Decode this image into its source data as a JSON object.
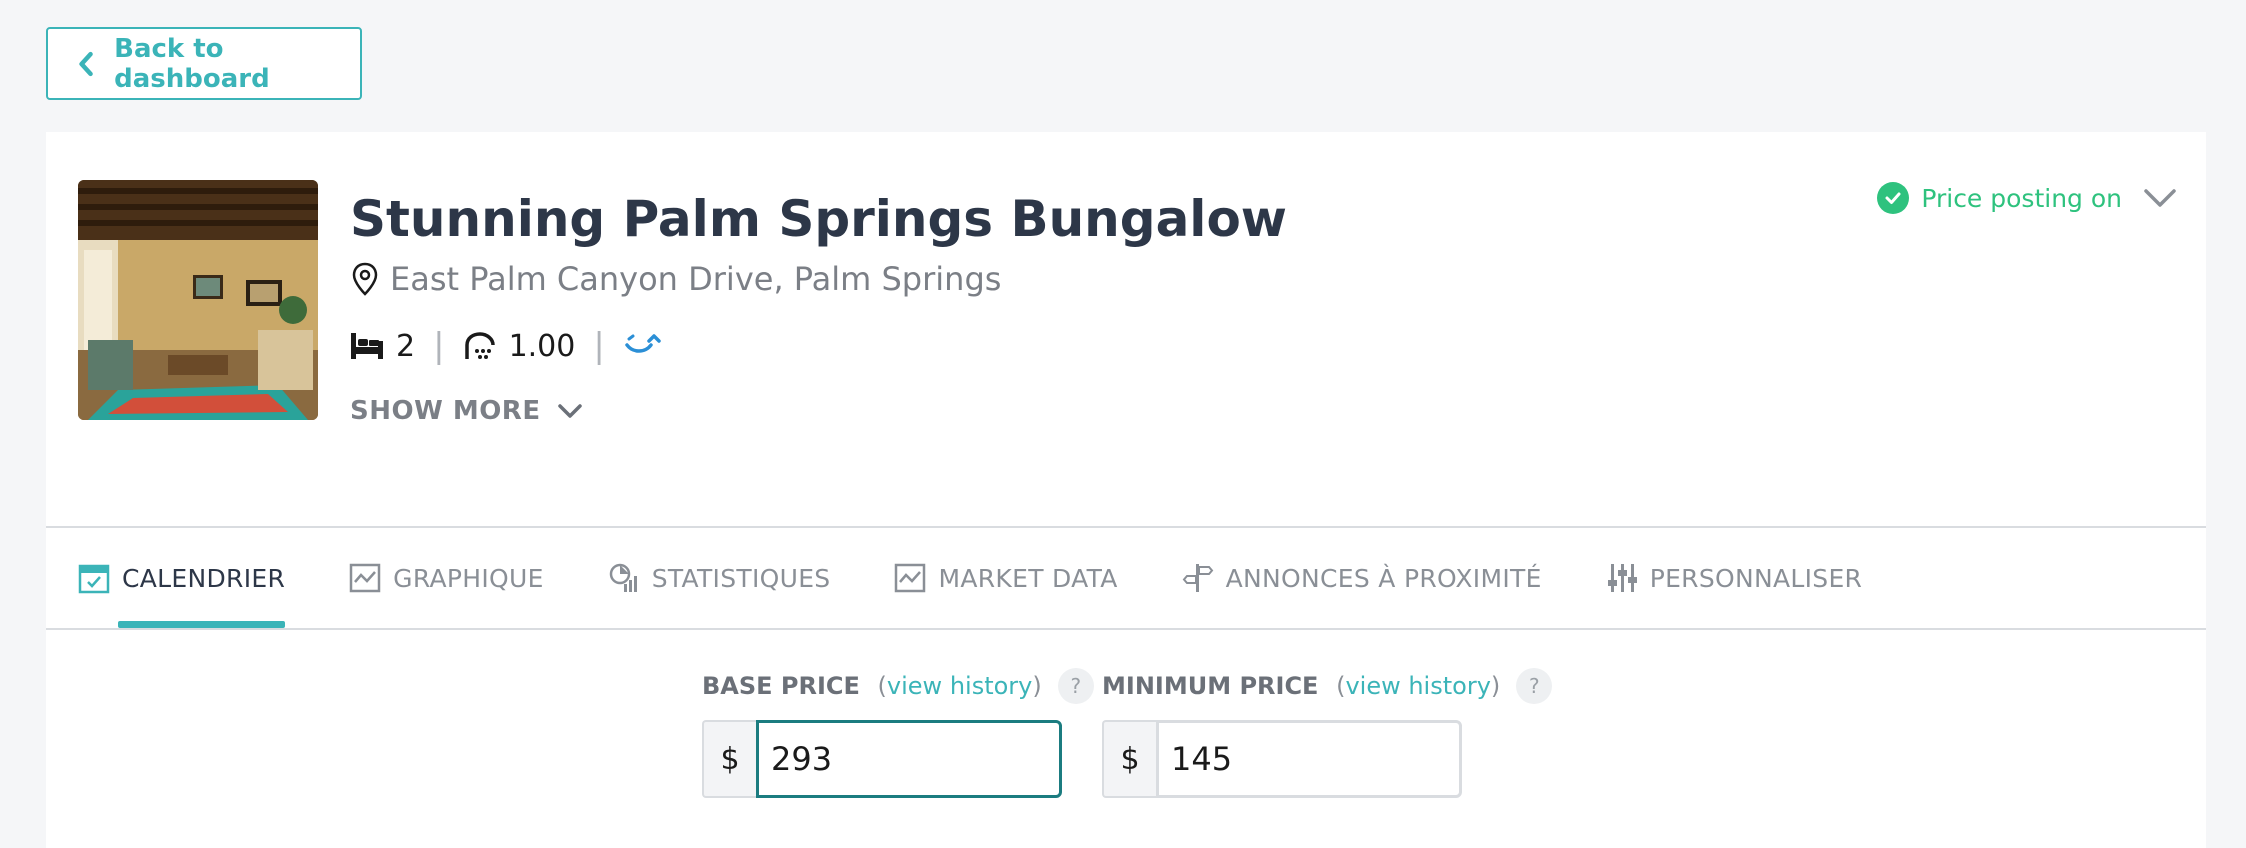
{
  "back_button": {
    "label": "Back to dashboard"
  },
  "listing": {
    "title": "Stunning Palm Springs Bungalow",
    "address": "East Palm Canyon Drive, Palm Springs",
    "bedrooms": "2",
    "bathrooms": "1.00",
    "show_more_label": "SHOW MORE",
    "photo_icon": "living-room-photo"
  },
  "posting": {
    "label": "Price posting on",
    "color": "#2ec27e"
  },
  "tabs": [
    {
      "label": "CALENDRIER",
      "icon": "calendar-icon",
      "active": true
    },
    {
      "label": "GRAPHIQUE",
      "icon": "chart-icon",
      "active": false
    },
    {
      "label": "STATISTIQUES",
      "icon": "statistics-icon",
      "active": false
    },
    {
      "label": "MARKET DATA",
      "icon": "market-chart-icon",
      "active": false
    },
    {
      "label": "ANNONCES À PROXIMITÉ",
      "icon": "signpost-icon",
      "active": false
    },
    {
      "label": "PERSONNALISER",
      "icon": "sliders-icon",
      "active": false
    }
  ],
  "base_price": {
    "label": "BASE PRICE",
    "history_link": "view history",
    "currency": "$",
    "value": "293",
    "help": "?"
  },
  "minimum_price": {
    "label": "MINIMUM PRICE",
    "history_link": "view history",
    "currency": "$",
    "value": "145",
    "help": "?"
  },
  "colors": {
    "accent": "#3bb4b8",
    "focus_border": "#1b7c80",
    "success": "#2ec27e"
  }
}
